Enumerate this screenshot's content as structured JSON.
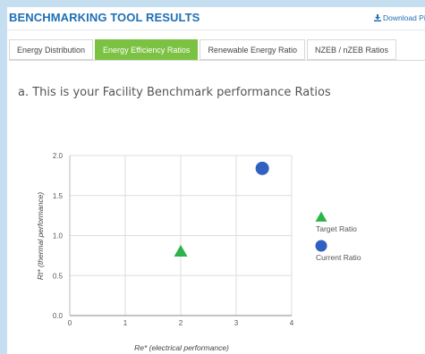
{
  "header": {
    "title": "BENCHMARKING TOOL RESULTS",
    "download_label": "Download Pi",
    "download_icon": "download-icon"
  },
  "tabs": [
    {
      "label": "Energy Distribution",
      "active": false
    },
    {
      "label": "Energy Efficiency Ratios",
      "active": true
    },
    {
      "label": "Renewable Energy Ratio",
      "active": false
    },
    {
      "label": "NZEB / nZEB Ratios",
      "active": false
    }
  ],
  "subtitle": "a. This is your Facility Benchmark performance Ratios",
  "colors": {
    "accent": "#7bc142",
    "brand": "#1f6fb5",
    "target": "#2cb34a",
    "current": "#3060c0"
  },
  "chart_data": {
    "type": "scatter",
    "xlabel": "Re* (electrical performance)",
    "ylabel": "Rt* (thermal performance)",
    "xlim": [
      0,
      4
    ],
    "ylim": [
      0,
      2
    ],
    "xticks": [
      "0",
      "1",
      "2",
      "3",
      "4"
    ],
    "yticks": [
      "0.0",
      "0.5",
      "1.0",
      "1.5",
      "2.0"
    ],
    "grid": true,
    "legend_position": "right",
    "series": [
      {
        "name": "Target Ratio",
        "marker": "triangle",
        "color": "#2cb34a",
        "points": [
          {
            "x": 2.0,
            "y": 0.8
          }
        ]
      },
      {
        "name": "Current Ratio",
        "marker": "circle",
        "color": "#3060c0",
        "points": [
          {
            "x": 3.47,
            "y": 1.84
          }
        ]
      }
    ]
  }
}
